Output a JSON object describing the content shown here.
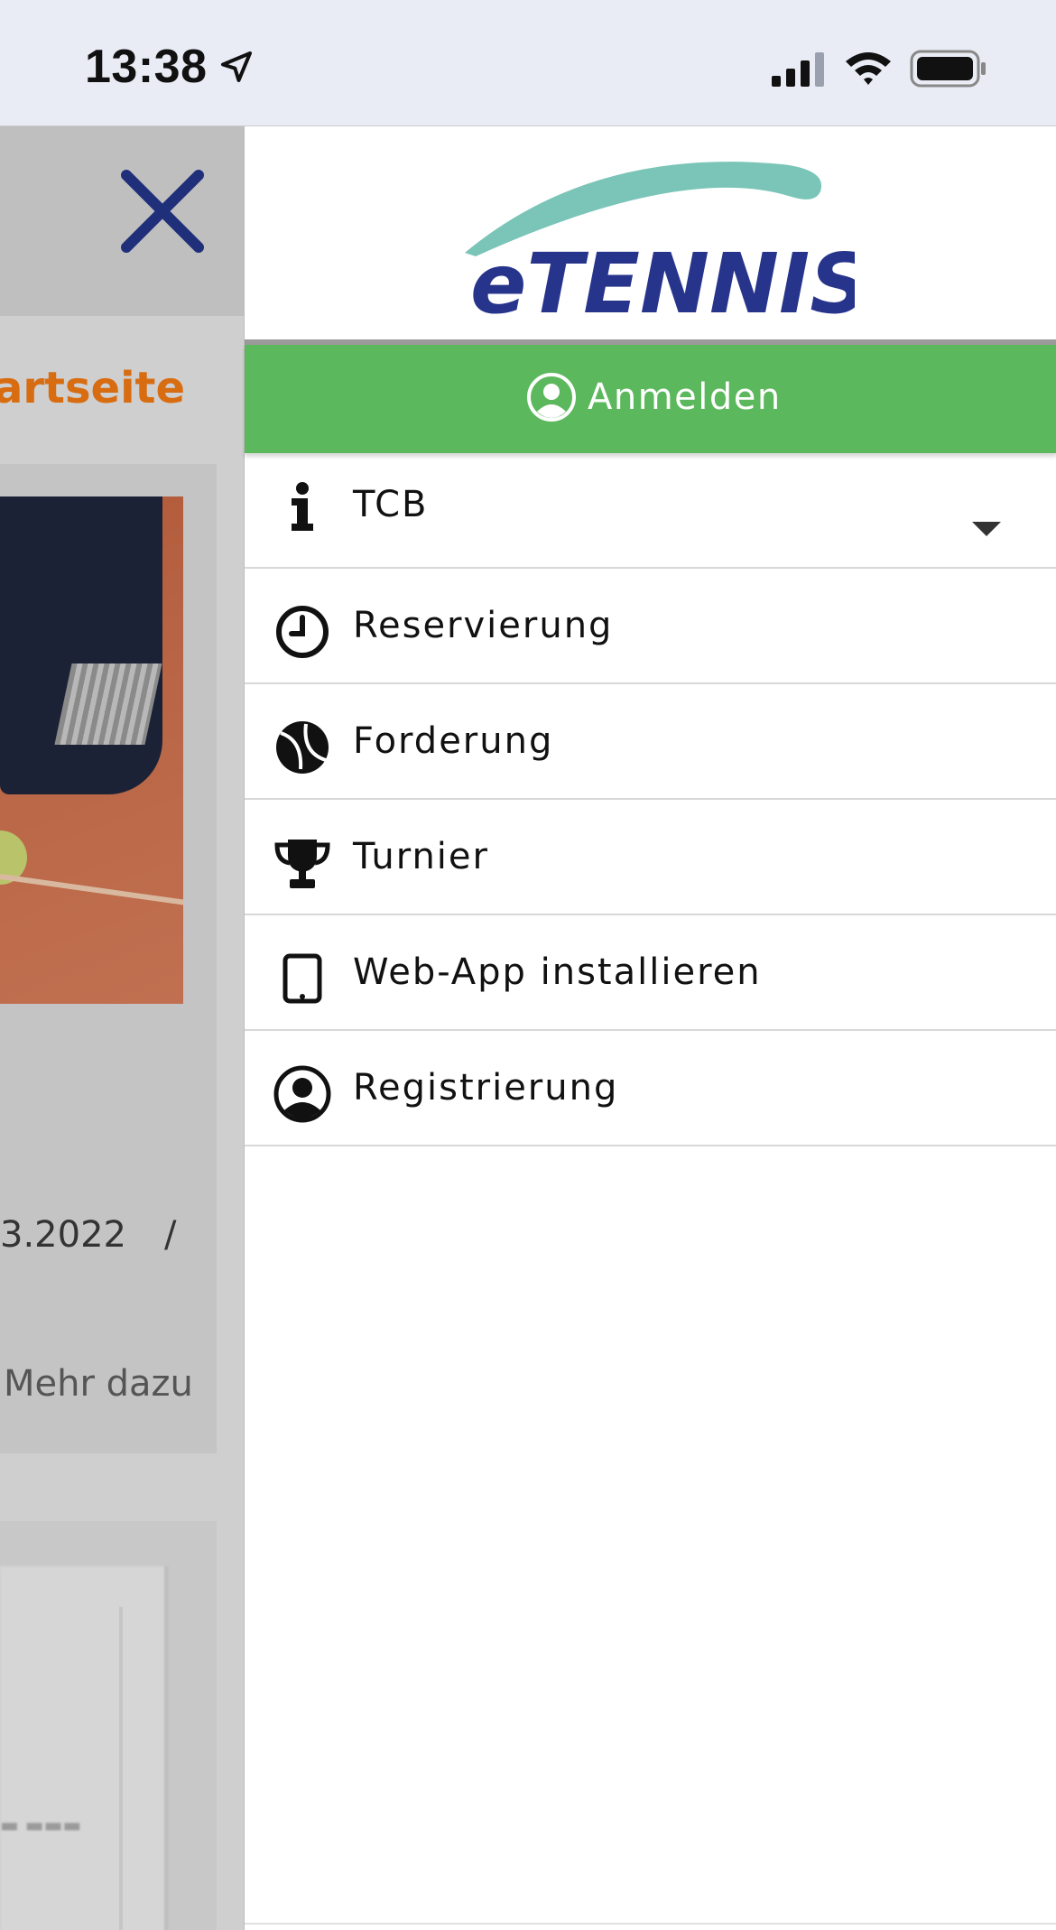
{
  "status_bar": {
    "time": "13:38",
    "icons": [
      "location-arrow-icon",
      "cellular-signal-icon",
      "wifi-icon",
      "battery-icon"
    ]
  },
  "background_page": {
    "title_fragment": "tartseite",
    "date_fragment": "3.2022",
    "separator": "/",
    "more_link": "Mehr dazu",
    "close_icon": "close-icon",
    "colors": {
      "title": "#d86c10",
      "close_icon": "#1f2f7a"
    }
  },
  "menu": {
    "logo": {
      "text": "eTENNIS",
      "colors": {
        "text": "#27348b",
        "swoosh": "#6cbfb0"
      }
    },
    "login": {
      "label": "Anmelden",
      "icon": "user-circle-icon",
      "color": "#5cb85c"
    },
    "items": [
      {
        "label": "TCB",
        "icon": "info-icon",
        "has_dropdown": true
      },
      {
        "label": "Reservierung",
        "icon": "clock-icon"
      },
      {
        "label": "Forderung",
        "icon": "tennis-ball-icon"
      },
      {
        "label": "Turnier",
        "icon": "trophy-icon"
      },
      {
        "label": "Web-App installieren",
        "icon": "tablet-icon"
      },
      {
        "label": "Registrierung",
        "icon": "user-circle-icon"
      }
    ]
  }
}
